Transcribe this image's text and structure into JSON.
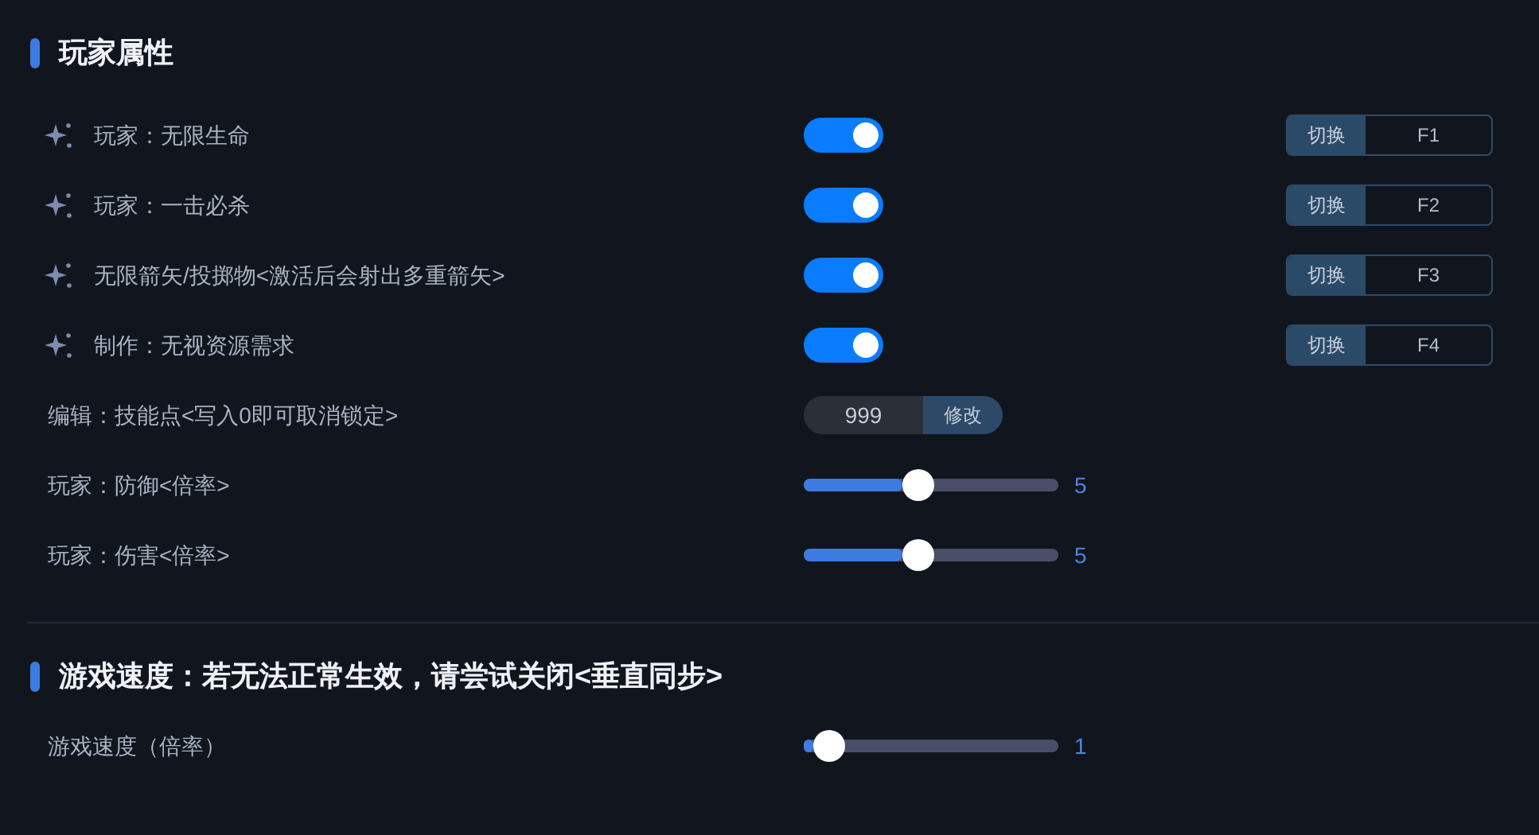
{
  "sections": [
    {
      "title": "玩家属性",
      "rows": [
        {
          "kind": "toggle",
          "label": "玩家：无限生命",
          "on": true,
          "hotkey_action": "切换",
          "hotkey": "F1"
        },
        {
          "kind": "toggle",
          "label": "玩家：一击必杀",
          "on": true,
          "hotkey_action": "切换",
          "hotkey": "F2"
        },
        {
          "kind": "toggle",
          "label": "无限箭矢/投掷物<激活后会射出多重箭矢>",
          "on": true,
          "hotkey_action": "切换",
          "hotkey": "F3"
        },
        {
          "kind": "toggle",
          "label": "制作：无视资源需求",
          "on": true,
          "hotkey_action": "切换",
          "hotkey": "F4"
        },
        {
          "kind": "number",
          "label": "编辑：技能点<写入0即可取消锁定>",
          "value": "999",
          "button": "修改"
        },
        {
          "kind": "slider",
          "label": "玩家：防御<倍率>",
          "level": 0.45,
          "reading": "5"
        },
        {
          "kind": "slider",
          "label": "玩家：伤害<倍率>",
          "level": 0.45,
          "reading": "5"
        }
      ]
    },
    {
      "title": "游戏速度：若无法正常生效，请尝试关闭<垂直同步>",
      "rows": [
        {
          "kind": "slider",
          "label": "游戏速度（倍率）",
          "level": 0.1,
          "reading": "1"
        }
      ]
    }
  ]
}
